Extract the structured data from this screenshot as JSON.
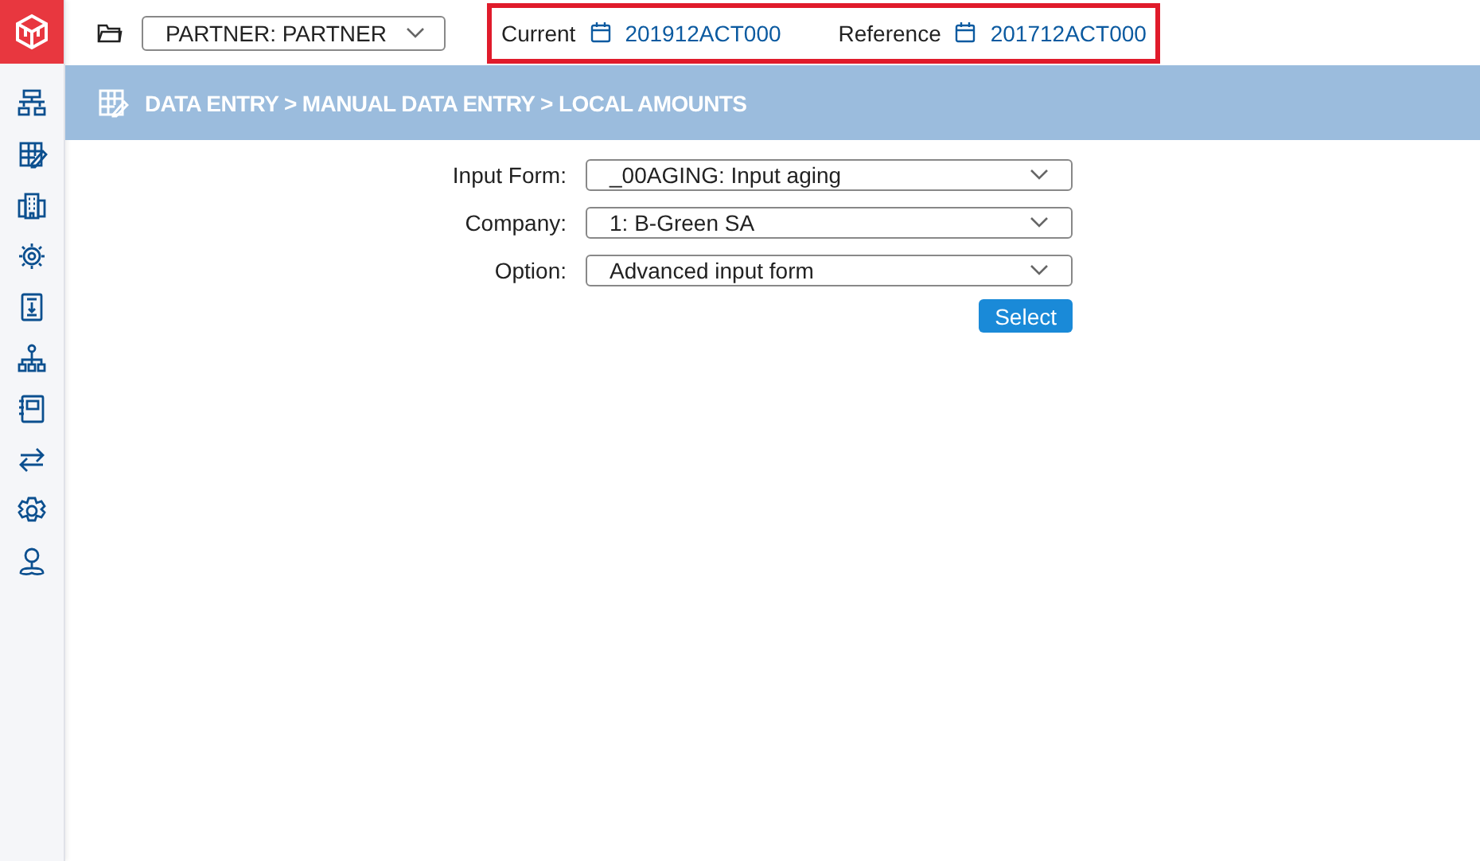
{
  "partner_selector": {
    "value": "PARTNER: PARTNER"
  },
  "periods": {
    "highlighted": true,
    "items": [
      {
        "label": "Current",
        "value": "201912ACT000"
      },
      {
        "label": "Reference",
        "value": "201712ACT000"
      }
    ]
  },
  "breadcrumb": "DATA ENTRY > MANUAL DATA ENTRY > LOCAL AMOUNTS",
  "sidebar": {
    "items": [
      {
        "kind": "hierarchy"
      },
      {
        "kind": "entry"
      },
      {
        "kind": "buildings"
      },
      {
        "kind": "process"
      },
      {
        "kind": "download"
      },
      {
        "kind": "tree"
      },
      {
        "kind": "notebook"
      },
      {
        "kind": "transfer"
      },
      {
        "kind": "settings"
      },
      {
        "kind": "user"
      }
    ]
  },
  "form": {
    "fields": [
      {
        "label": "Input Form:",
        "value": "_00AGING: Input aging"
      },
      {
        "label": "Company:",
        "value": "1: B-Green SA"
      },
      {
        "label": "Option:",
        "value": "Advanced input form"
      }
    ],
    "button": "Select"
  }
}
